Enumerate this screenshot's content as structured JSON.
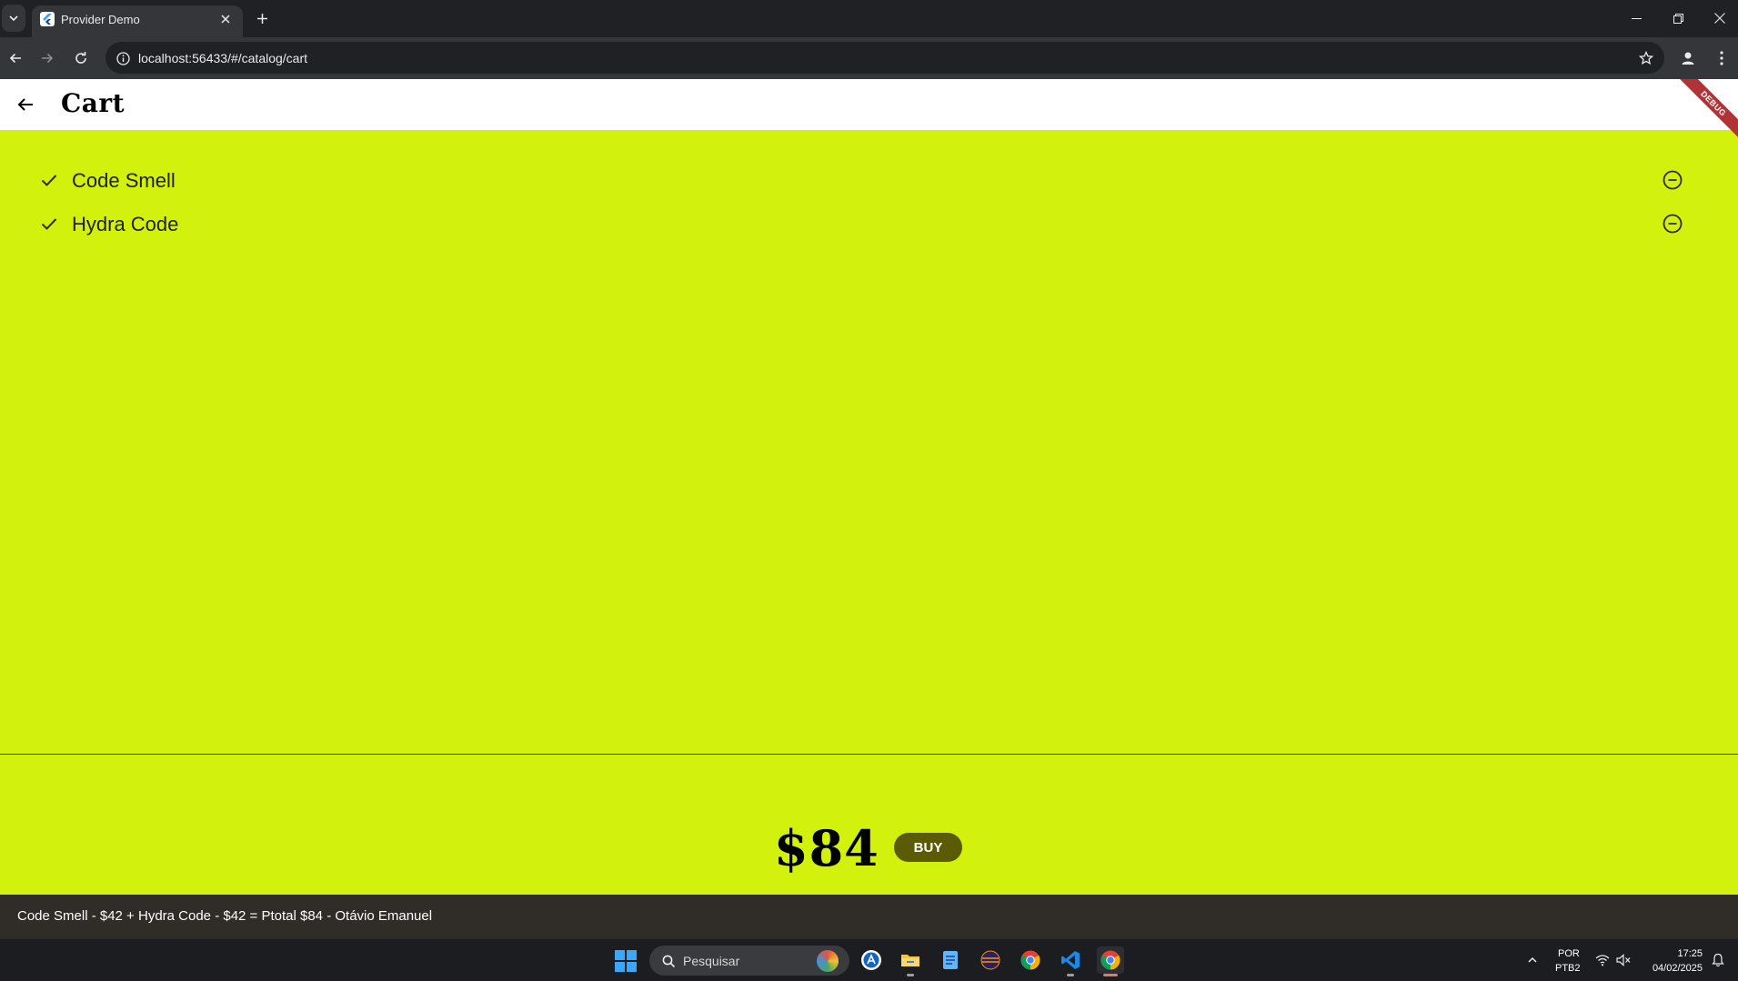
{
  "browser": {
    "tab_title": "Provider Demo",
    "url": "localhost:56433/#/catalog/cart"
  },
  "app": {
    "title": "Cart",
    "debug_banner": "DEBUG",
    "cart_items": [
      {
        "name": "Code Smell"
      },
      {
        "name": "Hydra Code"
      }
    ],
    "total": "$84",
    "buy_label": "BUY",
    "accent_color": "#d2f10c"
  },
  "caption": "Code Smell - $42 + Hydra Code - $42 = Ptotal $84 - Otávio Emanuel",
  "taskbar": {
    "search_placeholder": "Pesquisar",
    "language_line1": "POR",
    "language_line2": "PTB2",
    "time": "17:25",
    "date": "04/02/2025"
  }
}
